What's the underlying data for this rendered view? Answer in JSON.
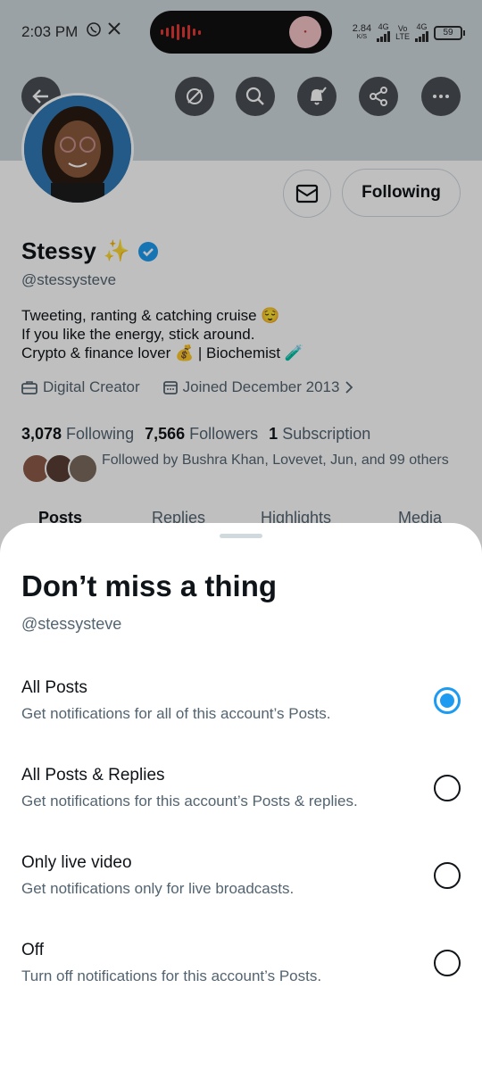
{
  "status_bar": {
    "time": "2:03 PM",
    "speed_value": "2.84",
    "speed_unit": "K/S",
    "net1": "4G",
    "net2_top": "Vo",
    "net2_bottom": "LTE",
    "net3": "4G",
    "battery": "59"
  },
  "profile": {
    "name": "Stessy",
    "name_emoji": "✨",
    "handle": "@stessysteve",
    "following_button": "Following",
    "bio": [
      "Tweeting, ranting & catching cruise 😌",
      "If you like the energy, stick around.",
      "Crypto & finance lover 💰 | Biochemist 🧪"
    ],
    "category": "Digital Creator",
    "joined": "Joined December 2013",
    "stats": {
      "following_count": "3,078",
      "following_label": "Following",
      "followers_count": "7,566",
      "followers_label": "Followers",
      "subscription_count": "1",
      "subscription_label": "Subscription"
    },
    "followed_by": "Followed by Bushra Khan, Lovevet, Jun, and 99 others",
    "tabs": [
      "Posts",
      "Replies",
      "Highlights",
      "Media"
    ]
  },
  "sheet": {
    "title": "Don’t miss a thing",
    "handle": "@stessysteve",
    "options": [
      {
        "label": "All Posts",
        "description": "Get notifications for all of this account’s Posts.",
        "selected": true
      },
      {
        "label": "All Posts & Replies",
        "description": "Get notifications for this account’s Posts & replies.",
        "selected": false
      },
      {
        "label": "Only live video",
        "description": "Get notifications only for live broadcasts.",
        "selected": false
      },
      {
        "label": "Off",
        "description": "Turn off notifications for this account’s Posts.",
        "selected": false
      }
    ]
  },
  "colors": {
    "accent": "#1d9bf0",
    "text": "#0f1419",
    "muted": "#536471"
  }
}
